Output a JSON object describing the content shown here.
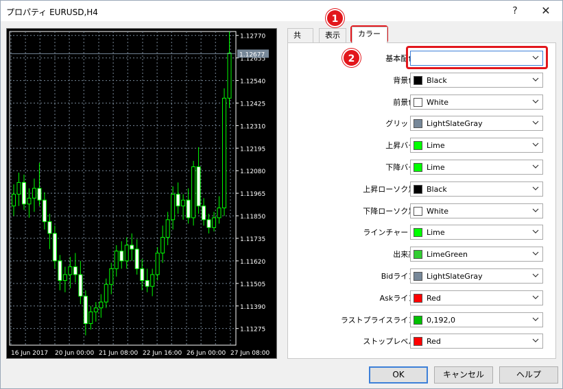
{
  "window": {
    "title": "プロパティ EURUSD,H4",
    "help_glyph": "?",
    "close_glyph": "✕"
  },
  "tabs": [
    {
      "label": "共有"
    },
    {
      "label": "表示"
    },
    {
      "label": "カラー"
    }
  ],
  "badges": [
    "1",
    "2"
  ],
  "colors_panel": {
    "rows": [
      {
        "label": "基本配色:",
        "value": "",
        "swatch": ""
      },
      {
        "label": "背景色:",
        "value": "Black",
        "swatch": "#000000"
      },
      {
        "label": "前景色:",
        "value": "White",
        "swatch": "#ffffff"
      },
      {
        "label": "グリッド:",
        "value": "LightSlateGray",
        "swatch": "#778899"
      },
      {
        "label": "上昇バー:",
        "value": "Lime",
        "swatch": "#00ff00"
      },
      {
        "label": "下降バー:",
        "value": "Lime",
        "swatch": "#00ff00"
      },
      {
        "label": "上昇ローソク足:",
        "value": "Black",
        "swatch": "#000000"
      },
      {
        "label": "下降ローソク足:",
        "value": "White",
        "swatch": "#ffffff"
      },
      {
        "label": "ラインチャート:",
        "value": "Lime",
        "swatch": "#00ff00"
      },
      {
        "label": "出来高:",
        "value": "LimeGreen",
        "swatch": "#32cd32"
      },
      {
        "label": "Bidライン:",
        "value": "LightSlateGray",
        "swatch": "#778899"
      },
      {
        "label": "Askライン:",
        "value": "Red",
        "swatch": "#ff0000"
      },
      {
        "label": "ラストプライスライン:",
        "value": "0,192,0",
        "swatch": "#00c000"
      },
      {
        "label": "ストップレベル:",
        "value": "Red",
        "swatch": "#ff0000"
      }
    ]
  },
  "buttons": {
    "ok": "OK",
    "cancel": "キャンセル",
    "help": "ヘルプ"
  },
  "chart_data": {
    "type": "candlestick",
    "price_labels": [
      "1.12770",
      "1.12655",
      "1.12540",
      "1.12425",
      "1.12310",
      "1.12195",
      "1.12080",
      "1.11965",
      "1.11850",
      "1.11735",
      "1.11620",
      "1.11505",
      "1.11390",
      "1.11275"
    ],
    "current_price": "1.12677",
    "time_labels": [
      "16 Jun 2017",
      "20 Jun 00:00",
      "21 Jun 08:00",
      "22 Jun 16:00",
      "26 Jun 00:00",
      "27 Jun 08:00"
    ],
    "ylim": [
      1.1119,
      1.1279
    ],
    "candles": [
      [
        1.119,
        1.1201,
        1.1185,
        1.1196
      ],
      [
        1.1196,
        1.1207,
        1.119,
        1.1202
      ],
      [
        1.1202,
        1.1206,
        1.1188,
        1.1191
      ],
      [
        1.1191,
        1.1199,
        1.1184,
        1.1194
      ],
      [
        1.1194,
        1.1204,
        1.1187,
        1.1199
      ],
      [
        1.1199,
        1.1212,
        1.119,
        1.1193
      ],
      [
        1.1193,
        1.1197,
        1.1178,
        1.1182
      ],
      [
        1.1182,
        1.1186,
        1.1168,
        1.1176
      ],
      [
        1.1176,
        1.118,
        1.1158,
        1.1162
      ],
      [
        1.1162,
        1.1165,
        1.1147,
        1.1152
      ],
      [
        1.1152,
        1.1159,
        1.1146,
        1.1155
      ],
      [
        1.1155,
        1.1164,
        1.1148,
        1.1159
      ],
      [
        1.1159,
        1.1166,
        1.1151,
        1.1155
      ],
      [
        1.1155,
        1.1162,
        1.114,
        1.1144
      ],
      [
        1.1144,
        1.1147,
        1.1124,
        1.113
      ],
      [
        1.113,
        1.1139,
        1.1127,
        1.1136
      ],
      [
        1.1136,
        1.1141,
        1.1131,
        1.1138
      ],
      [
        1.1138,
        1.1145,
        1.1133,
        1.1141
      ],
      [
        1.1141,
        1.1153,
        1.1138,
        1.115
      ],
      [
        1.115,
        1.1161,
        1.1145,
        1.1158
      ],
      [
        1.1158,
        1.117,
        1.1154,
        1.1167
      ],
      [
        1.1167,
        1.1172,
        1.1158,
        1.1162
      ],
      [
        1.1162,
        1.1174,
        1.1158,
        1.117
      ],
      [
        1.117,
        1.1176,
        1.1162,
        1.1168
      ],
      [
        1.1168,
        1.1173,
        1.1155,
        1.1158
      ],
      [
        1.1158,
        1.1163,
        1.1147,
        1.1152
      ],
      [
        1.1152,
        1.1158,
        1.1146,
        1.1149
      ],
      [
        1.1149,
        1.1158,
        1.1144,
        1.1155
      ],
      [
        1.1155,
        1.1169,
        1.1152,
        1.1166
      ],
      [
        1.1166,
        1.118,
        1.1161,
        1.1174
      ],
      [
        1.1174,
        1.1187,
        1.117,
        1.1183
      ],
      [
        1.1183,
        1.12,
        1.1178,
        1.1196
      ],
      [
        1.1196,
        1.1202,
        1.1186,
        1.119
      ],
      [
        1.119,
        1.1196,
        1.1183,
        1.1193
      ],
      [
        1.1193,
        1.1199,
        1.1181,
        1.1184
      ],
      [
        1.1184,
        1.1213,
        1.118,
        1.121
      ],
      [
        1.121,
        1.122,
        1.1186,
        1.119
      ],
      [
        1.119,
        1.1194,
        1.118,
        1.1183
      ],
      [
        1.1183,
        1.1186,
        1.1176,
        1.1179
      ],
      [
        1.1179,
        1.1187,
        1.1177,
        1.1184
      ],
      [
        1.1184,
        1.1195,
        1.1181,
        1.1189
      ],
      [
        1.1189,
        1.125,
        1.1185,
        1.1245
      ],
      [
        1.1245,
        1.1279,
        1.124,
        1.1268
      ]
    ]
  }
}
